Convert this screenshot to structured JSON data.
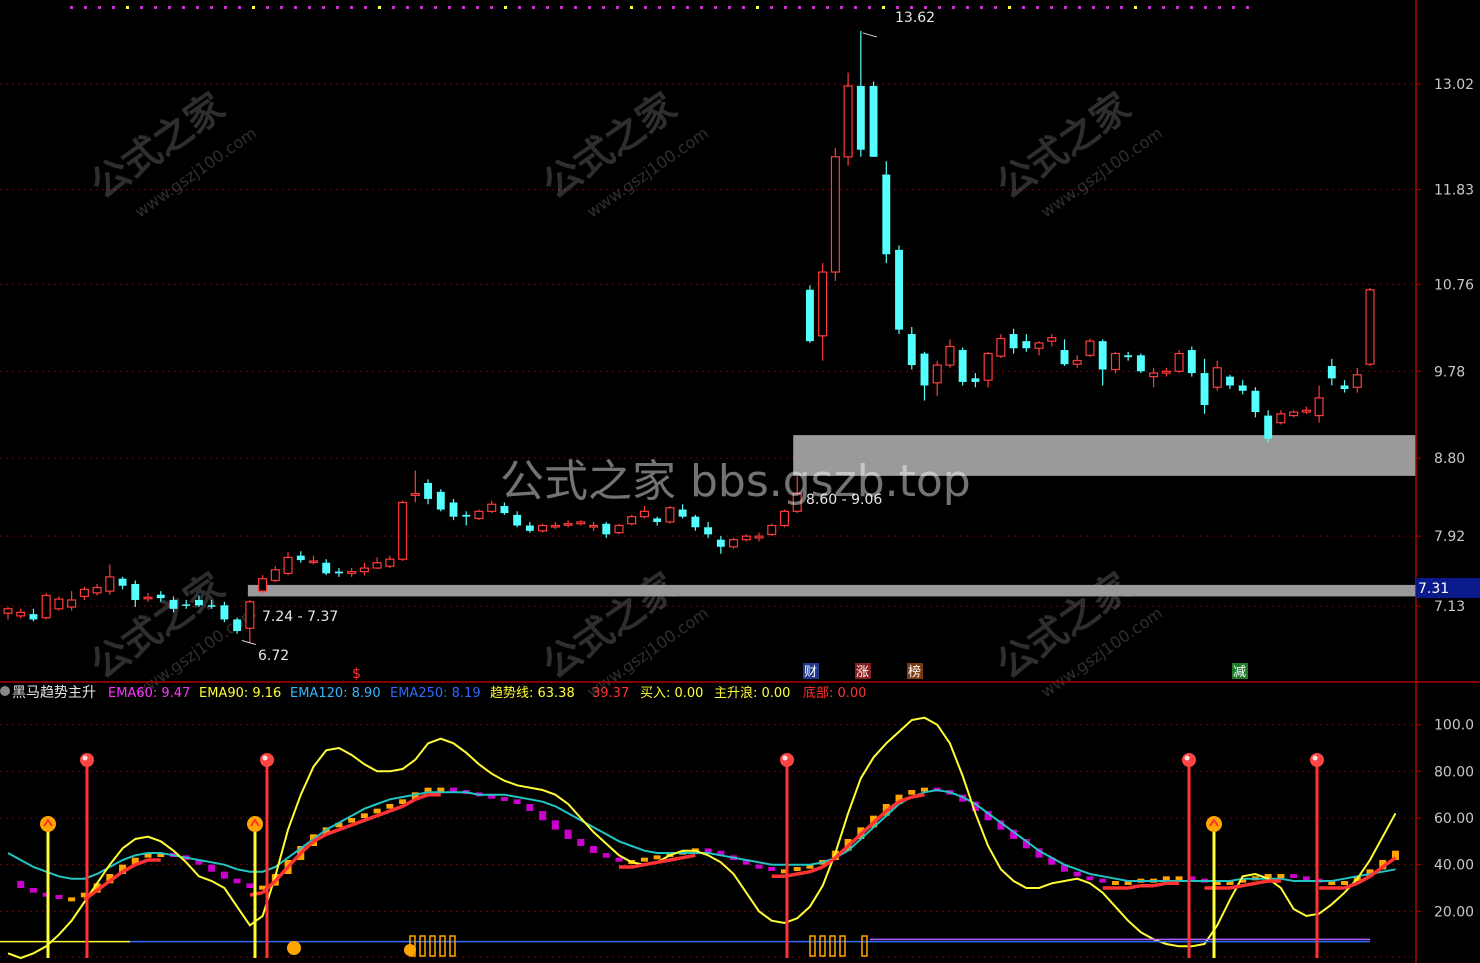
{
  "colors": {
    "background": "#000000",
    "grid": "#7a0000",
    "axis": "#b00000",
    "axis_text": "#c8c8c8",
    "up_candle": "#ff3b3b",
    "down_candle": "#54ffff",
    "zone": "#9a9a9a",
    "ema60": "#ff33ff",
    "ema90": "#ffff33",
    "ema120": "#33b7ff",
    "ema250": "#2f6bff",
    "trend": "#ffff33",
    "signal": "#ff3333",
    "orange": "#ffa500",
    "magenta": "#cc00cc",
    "cyan_line": "#22c4c4"
  },
  "watermarks": {
    "site_cn": "公式之家",
    "site_url": "www.gszj100.com",
    "center_text": "公式之家 bbs.gszb.top"
  },
  "price_panel": {
    "price_ticks": [
      "13.02",
      "11.83",
      "10.76",
      "9.78",
      "8.80",
      "7.92",
      "7.13"
    ],
    "current_price_label": "7.31",
    "high_label": "13.62",
    "low_label": "6.72",
    "zone_upper_label": "8.60 - 9.06",
    "zone_lower_label": "7.24 - 7.37",
    "event_markers": [
      {
        "text": "$",
        "color": "#ff3333"
      },
      {
        "text": "财",
        "color": "#ffffff",
        "bg": "#1f3a8a"
      },
      {
        "text": "涨",
        "color": "#ffffff",
        "bg": "#8a1f1f"
      },
      {
        "text": "榜",
        "color": "#ffffff",
        "bg": "#7a3a10"
      },
      {
        "text": "减",
        "color": "#ffffff",
        "bg": "#1f7a2a"
      }
    ]
  },
  "indicator_panel": {
    "title": "黑马趋势主升",
    "legend": [
      {
        "label": "EMA60: 9.47",
        "color": "#ff33ff"
      },
      {
        "label": "EMA90: 9.16",
        "color": "#ffff33"
      },
      {
        "label": "EMA120: 8.90",
        "color": "#33b7ff"
      },
      {
        "label": "EMA250: 8.19",
        "color": "#2f6bff"
      },
      {
        "label": "趋势线: 63.38",
        "color": "#ffff33"
      },
      {
        "label": "39.37",
        "color": "#ff3333"
      },
      {
        "label": "买入: 0.00",
        "color": "#ffff33"
      },
      {
        "label": "主升浪: 0.00",
        "color": "#ffff33"
      },
      {
        "label": "底部: 0.00",
        "color": "#ff3333"
      }
    ],
    "y_ticks": [
      "100.0",
      "80.00",
      "60.00",
      "40.00",
      "20.00"
    ]
  },
  "chart_data": [
    {
      "type": "candlestick",
      "y_axis": "price",
      "ylim": [
        6.5,
        13.8
      ],
      "y_ticks": [
        13.02,
        11.83,
        10.76,
        9.78,
        8.8,
        7.92,
        7.13
      ],
      "candles": [
        {
          "o": 7.05,
          "h": 7.12,
          "l": 6.98,
          "c": 7.1
        },
        {
          "o": 7.02,
          "h": 7.1,
          "l": 6.99,
          "c": 7.06
        },
        {
          "o": 7.04,
          "h": 7.1,
          "l": 6.96,
          "c": 6.98
        },
        {
          "o": 7.0,
          "h": 7.28,
          "l": 6.98,
          "c": 7.25
        },
        {
          "o": 7.1,
          "h": 7.24,
          "l": 7.08,
          "c": 7.21
        },
        {
          "o": 7.12,
          "h": 7.3,
          "l": 7.08,
          "c": 7.2
        },
        {
          "o": 7.24,
          "h": 7.35,
          "l": 7.2,
          "c": 7.32
        },
        {
          "o": 7.28,
          "h": 7.38,
          "l": 7.25,
          "c": 7.34
        },
        {
          "o": 7.3,
          "h": 7.6,
          "l": 7.26,
          "c": 7.46
        },
        {
          "o": 7.44,
          "h": 7.46,
          "l": 7.32,
          "c": 7.36
        },
        {
          "o": 7.38,
          "h": 7.42,
          "l": 7.12,
          "c": 7.2
        },
        {
          "o": 7.22,
          "h": 7.28,
          "l": 7.18,
          "c": 7.23
        },
        {
          "o": 7.26,
          "h": 7.3,
          "l": 7.18,
          "c": 7.22
        },
        {
          "o": 7.2,
          "h": 7.24,
          "l": 7.06,
          "c": 7.1
        },
        {
          "o": 7.15,
          "h": 7.2,
          "l": 7.1,
          "c": 7.14
        },
        {
          "o": 7.2,
          "h": 7.25,
          "l": 7.12,
          "c": 7.14
        },
        {
          "o": 7.14,
          "h": 7.2,
          "l": 7.1,
          "c": 7.13
        },
        {
          "o": 7.14,
          "h": 7.18,
          "l": 6.95,
          "c": 6.98
        },
        {
          "o": 6.98,
          "h": 7.0,
          "l": 6.82,
          "c": 6.85
        },
        {
          "o": 6.88,
          "h": 7.2,
          "l": 6.72,
          "c": 7.18
        },
        {
          "o": 7.3,
          "h": 7.48,
          "l": 7.28,
          "c": 7.44
        },
        {
          "o": 7.42,
          "h": 7.58,
          "l": 7.4,
          "c": 7.54
        },
        {
          "o": 7.5,
          "h": 7.74,
          "l": 7.48,
          "c": 7.68
        },
        {
          "o": 7.7,
          "h": 7.75,
          "l": 7.62,
          "c": 7.65
        },
        {
          "o": 7.64,
          "h": 7.7,
          "l": 7.6,
          "c": 7.64
        },
        {
          "o": 7.62,
          "h": 7.66,
          "l": 7.48,
          "c": 7.5
        },
        {
          "o": 7.52,
          "h": 7.56,
          "l": 7.46,
          "c": 7.5
        },
        {
          "o": 7.5,
          "h": 7.56,
          "l": 7.46,
          "c": 7.52
        },
        {
          "o": 7.52,
          "h": 7.62,
          "l": 7.48,
          "c": 7.56
        },
        {
          "o": 7.56,
          "h": 7.68,
          "l": 7.55,
          "c": 7.62
        },
        {
          "o": 7.58,
          "h": 7.7,
          "l": 7.56,
          "c": 7.66
        },
        {
          "o": 7.66,
          "h": 8.32,
          "l": 7.64,
          "c": 8.3
        },
        {
          "o": 8.38,
          "h": 8.66,
          "l": 8.3,
          "c": 8.4
        },
        {
          "o": 8.52,
          "h": 8.56,
          "l": 8.28,
          "c": 8.34
        },
        {
          "o": 8.42,
          "h": 8.45,
          "l": 8.2,
          "c": 8.22
        },
        {
          "o": 8.3,
          "h": 8.34,
          "l": 8.1,
          "c": 8.14
        },
        {
          "o": 8.16,
          "h": 8.2,
          "l": 8.04,
          "c": 8.14
        },
        {
          "o": 8.12,
          "h": 8.22,
          "l": 8.1,
          "c": 8.2
        },
        {
          "o": 8.2,
          "h": 8.32,
          "l": 8.18,
          "c": 8.28
        },
        {
          "o": 8.26,
          "h": 8.3,
          "l": 8.16,
          "c": 8.18
        },
        {
          "o": 8.16,
          "h": 8.2,
          "l": 8.02,
          "c": 8.04
        },
        {
          "o": 8.04,
          "h": 8.08,
          "l": 7.96,
          "c": 7.98
        },
        {
          "o": 7.98,
          "h": 8.06,
          "l": 7.96,
          "c": 8.04
        },
        {
          "o": 8.04,
          "h": 8.08,
          "l": 8.0,
          "c": 8.04
        },
        {
          "o": 8.06,
          "h": 8.1,
          "l": 8.02,
          "c": 8.06
        },
        {
          "o": 8.06,
          "h": 8.1,
          "l": 8.04,
          "c": 8.08
        },
        {
          "o": 8.04,
          "h": 8.08,
          "l": 7.98,
          "c": 8.04
        },
        {
          "o": 8.06,
          "h": 8.08,
          "l": 7.9,
          "c": 7.94
        },
        {
          "o": 7.96,
          "h": 8.06,
          "l": 7.94,
          "c": 8.04
        },
        {
          "o": 8.06,
          "h": 8.16,
          "l": 8.04,
          "c": 8.14
        },
        {
          "o": 8.14,
          "h": 8.26,
          "l": 8.12,
          "c": 8.2
        },
        {
          "o": 8.12,
          "h": 8.14,
          "l": 8.04,
          "c": 8.08
        },
        {
          "o": 8.08,
          "h": 8.26,
          "l": 8.06,
          "c": 8.24
        },
        {
          "o": 8.22,
          "h": 8.28,
          "l": 8.12,
          "c": 8.14
        },
        {
          "o": 8.14,
          "h": 8.16,
          "l": 7.98,
          "c": 8.02
        },
        {
          "o": 8.02,
          "h": 8.08,
          "l": 7.9,
          "c": 7.94
        },
        {
          "o": 7.88,
          "h": 7.92,
          "l": 7.72,
          "c": 7.8
        },
        {
          "o": 7.8,
          "h": 7.9,
          "l": 7.78,
          "c": 7.88
        },
        {
          "o": 7.88,
          "h": 7.94,
          "l": 7.86,
          "c": 7.92
        },
        {
          "o": 7.9,
          "h": 7.96,
          "l": 7.86,
          "c": 7.92
        },
        {
          "o": 7.94,
          "h": 8.06,
          "l": 7.92,
          "c": 8.04
        },
        {
          "o": 8.04,
          "h": 8.22,
          "l": 8.02,
          "c": 8.2
        },
        {
          "o": 8.2,
          "h": 8.6,
          "l": 8.18,
          "c": 8.4
        },
        {
          "o": 10.7,
          "h": 10.75,
          "l": 10.1,
          "c": 10.12
        },
        {
          "o": 10.18,
          "h": 11.0,
          "l": 9.9,
          "c": 10.9
        },
        {
          "o": 10.9,
          "h": 12.3,
          "l": 10.8,
          "c": 12.2
        },
        {
          "o": 12.2,
          "h": 13.15,
          "l": 12.1,
          "c": 13.0
        },
        {
          "o": 13.0,
          "h": 13.62,
          "l": 12.2,
          "c": 12.28
        },
        {
          "o": 13.0,
          "h": 13.05,
          "l": 12.2,
          "c": 12.2
        },
        {
          "o": 12.0,
          "h": 12.15,
          "l": 11.0,
          "c": 11.1
        },
        {
          "o": 11.15,
          "h": 11.2,
          "l": 10.2,
          "c": 10.25
        },
        {
          "o": 10.2,
          "h": 10.28,
          "l": 9.8,
          "c": 9.85
        },
        {
          "o": 9.98,
          "h": 10.0,
          "l": 9.45,
          "c": 9.62
        },
        {
          "o": 9.65,
          "h": 9.9,
          "l": 9.5,
          "c": 9.85
        },
        {
          "o": 9.85,
          "h": 10.14,
          "l": 9.82,
          "c": 10.06
        },
        {
          "o": 10.02,
          "h": 10.05,
          "l": 9.62,
          "c": 9.66
        },
        {
          "o": 9.7,
          "h": 9.76,
          "l": 9.6,
          "c": 9.66
        },
        {
          "o": 9.68,
          "h": 10.0,
          "l": 9.6,
          "c": 9.98
        },
        {
          "o": 9.95,
          "h": 10.2,
          "l": 9.93,
          "c": 10.15
        },
        {
          "o": 10.2,
          "h": 10.26,
          "l": 9.98,
          "c": 10.04
        },
        {
          "o": 10.12,
          "h": 10.2,
          "l": 10.0,
          "c": 10.04
        },
        {
          "o": 10.04,
          "h": 10.12,
          "l": 9.96,
          "c": 10.1
        },
        {
          "o": 10.12,
          "h": 10.2,
          "l": 10.06,
          "c": 10.16
        },
        {
          "o": 10.02,
          "h": 10.14,
          "l": 9.84,
          "c": 9.86
        },
        {
          "o": 9.86,
          "h": 9.96,
          "l": 9.82,
          "c": 9.9
        },
        {
          "o": 9.96,
          "h": 10.15,
          "l": 9.94,
          "c": 10.12
        },
        {
          "o": 10.12,
          "h": 10.14,
          "l": 9.62,
          "c": 9.8
        },
        {
          "o": 9.8,
          "h": 10.0,
          "l": 9.76,
          "c": 9.98
        },
        {
          "o": 9.96,
          "h": 10.0,
          "l": 9.9,
          "c": 9.94
        },
        {
          "o": 9.96,
          "h": 9.98,
          "l": 9.76,
          "c": 9.78
        },
        {
          "o": 9.72,
          "h": 9.82,
          "l": 9.6,
          "c": 9.76
        },
        {
          "o": 9.76,
          "h": 9.82,
          "l": 9.72,
          "c": 9.78
        },
        {
          "o": 9.78,
          "h": 10.02,
          "l": 9.76,
          "c": 9.98
        },
        {
          "o": 10.02,
          "h": 10.06,
          "l": 9.72,
          "c": 9.76
        },
        {
          "o": 9.76,
          "h": 9.92,
          "l": 9.3,
          "c": 9.4
        },
        {
          "o": 9.6,
          "h": 9.9,
          "l": 9.56,
          "c": 9.82
        },
        {
          "o": 9.72,
          "h": 9.74,
          "l": 9.58,
          "c": 9.62
        },
        {
          "o": 9.62,
          "h": 9.68,
          "l": 9.52,
          "c": 9.56
        },
        {
          "o": 9.56,
          "h": 9.6,
          "l": 9.26,
          "c": 9.32
        },
        {
          "o": 9.28,
          "h": 9.34,
          "l": 8.98,
          "c": 9.02
        },
        {
          "o": 9.2,
          "h": 9.34,
          "l": 9.18,
          "c": 9.3
        },
        {
          "o": 9.28,
          "h": 9.34,
          "l": 9.26,
          "c": 9.32
        },
        {
          "o": 9.32,
          "h": 9.38,
          "l": 9.3,
          "c": 9.34
        },
        {
          "o": 9.28,
          "h": 9.62,
          "l": 9.2,
          "c": 9.48
        },
        {
          "o": 9.84,
          "h": 9.92,
          "l": 9.62,
          "c": 9.7
        },
        {
          "o": 9.62,
          "h": 9.68,
          "l": 9.54,
          "c": 9.58
        },
        {
          "o": 9.6,
          "h": 9.82,
          "l": 9.54,
          "c": 9.74
        },
        {
          "o": 9.86,
          "h": 10.72,
          "l": 9.84,
          "c": 10.7
        }
      ],
      "zones": [
        {
          "low": 7.24,
          "high": 7.37
        },
        {
          "low": 8.6,
          "high": 9.06
        }
      ]
    },
    {
      "type": "line",
      "y_axis": "indicator",
      "ylim": [
        0,
        108
      ],
      "y_ticks": [
        100,
        80,
        60,
        40,
        20
      ],
      "series": [
        {
          "name": "趋势线",
          "color": "#ffff33",
          "values": [
            2,
            0,
            2,
            5,
            10,
            16,
            24,
            32,
            40,
            47,
            51,
            52,
            50,
            46,
            41,
            35,
            33,
            30,
            22,
            14,
            18,
            35,
            55,
            70,
            82,
            89,
            90,
            87,
            83,
            80,
            80,
            81,
            85,
            92,
            94,
            92,
            88,
            83,
            79,
            76,
            74,
            73,
            72,
            70,
            66,
            60,
            54,
            49,
            44,
            41,
            40,
            41,
            44,
            46,
            46,
            44,
            41,
            36,
            28,
            20,
            16,
            15,
            17,
            22,
            31,
            45,
            62,
            77,
            86,
            92,
            97,
            102,
            103,
            100,
            92,
            78,
            62,
            48,
            38,
            33,
            30,
            30,
            32,
            33,
            34,
            32,
            28,
            22,
            16,
            11,
            8,
            6,
            5,
            5,
            6,
            14,
            25,
            35,
            36,
            34,
            30,
            21,
            18,
            19,
            23,
            28,
            34,
            42,
            52,
            62
          ]
        },
        {
          "name": "",
          "color": "#22c4c4",
          "values": [
            45,
            42,
            39,
            37,
            35,
            34,
            34,
            36,
            39,
            42,
            44,
            45,
            45,
            44,
            43,
            42,
            41,
            40,
            38,
            37,
            37,
            39,
            43,
            47,
            51,
            55,
            58,
            61,
            64,
            66,
            68,
            69,
            70,
            71,
            71,
            71,
            71,
            70,
            70,
            70,
            69,
            68,
            67,
            65,
            62,
            59,
            56,
            53,
            50,
            48,
            46,
            45,
            45,
            45,
            45,
            45,
            44,
            43,
            42,
            41,
            40,
            40,
            40,
            40,
            41,
            43,
            46,
            51,
            56,
            61,
            66,
            69,
            71,
            72,
            71,
            69,
            66,
            62,
            58,
            54,
            50,
            46,
            43,
            40,
            38,
            36,
            35,
            34,
            33,
            33,
            33,
            33,
            33,
            33,
            33,
            33,
            33,
            34,
            34,
            34,
            34,
            33,
            33,
            33,
            33,
            34,
            35,
            36,
            37,
            38
          ]
        }
      ],
      "bar_series": [
        {
          "name": "EMA60",
          "color": "#ff33ff",
          "values": [
            33,
            30,
            28,
            27,
            26,
            26,
            28,
            32,
            36,
            40,
            43,
            45,
            45,
            44,
            42,
            40,
            37,
            34,
            32,
            30,
            31,
            36,
            42,
            48,
            53,
            56,
            58,
            60,
            62,
            64,
            66,
            68,
            71,
            73,
            73,
            72,
            71,
            70,
            69,
            68,
            66,
            63,
            59,
            55,
            51,
            48,
            45,
            43,
            42,
            42,
            43,
            44,
            45,
            46,
            47,
            46,
            44,
            42,
            40,
            39,
            38,
            38,
            39,
            40,
            42,
            46,
            51,
            56,
            61,
            66,
            70,
            72,
            73,
            72,
            70,
            67,
            63,
            59,
            55,
            51,
            47,
            43,
            40,
            37,
            35,
            34,
            33,
            33,
            33,
            34,
            34,
            35,
            35,
            34,
            33,
            33,
            33,
            34,
            35,
            36,
            36,
            35,
            34,
            33,
            33,
            33,
            35,
            38,
            42,
            46
          ]
        }
      ],
      "signals": {
        "red_spikes": 6,
        "yellow_spikes": 4
      }
    }
  ]
}
